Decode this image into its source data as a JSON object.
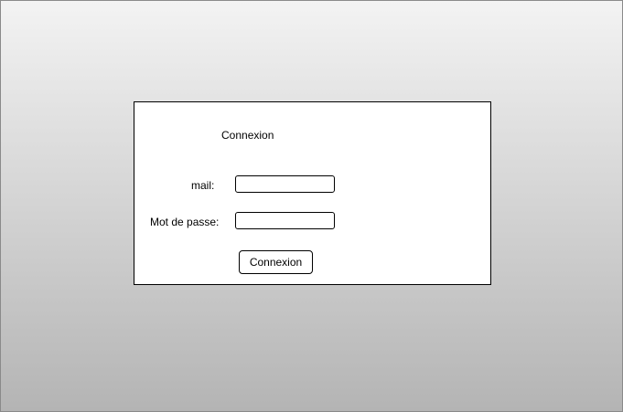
{
  "login": {
    "title": "Connexion",
    "mail_label": "mail:",
    "mail_value": "",
    "password_label": "Mot de passe:",
    "password_value": "",
    "submit_label": "Connexion"
  }
}
